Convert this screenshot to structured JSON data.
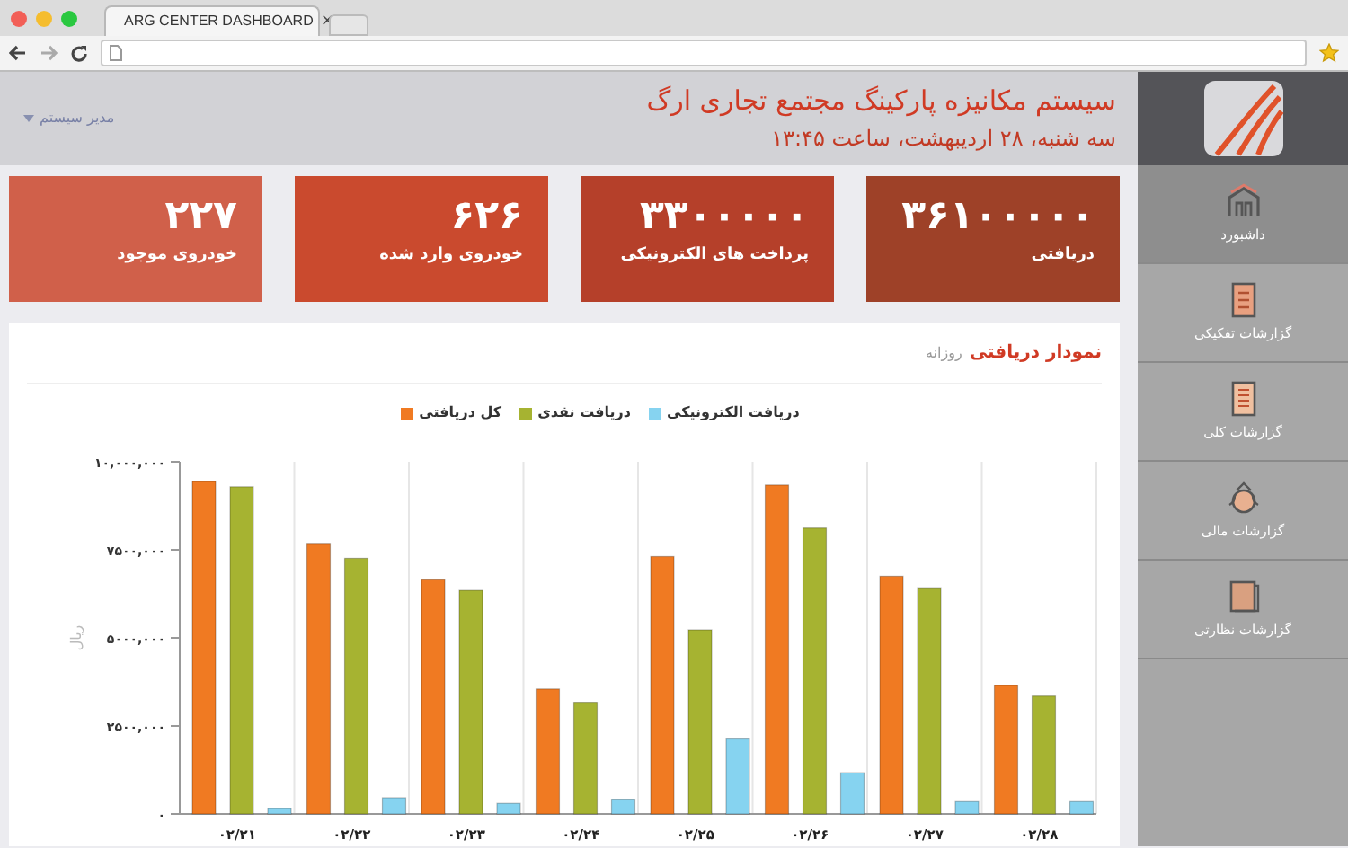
{
  "browser": {
    "tab_title": "ARG CENTER DASHBOARD",
    "tab_close": "×"
  },
  "header": {
    "title": "سیستم مکانیزه پارکینگ مجتمع تجاری ارگ",
    "date": "سه شنبه، ۲۸ اردیبهشت، ساعت ۱۳:۴۵",
    "user": "مدیر سیستم"
  },
  "sidebar": {
    "items": [
      {
        "label": "داشبورد",
        "kind": "home",
        "selected": true
      },
      {
        "label": "گزارشات تفکیکی",
        "kind": "report",
        "selected": false
      },
      {
        "label": "گزارشات کلی",
        "kind": "list",
        "selected": false
      },
      {
        "label": "گزارشات مالی",
        "kind": "money",
        "selected": false
      },
      {
        "label": "گزارشات نظارتی",
        "kind": "book",
        "selected": false
      }
    ]
  },
  "stats": [
    {
      "value": "۳۶۱۰۰۰۰۰",
      "label": "دریافتی",
      "color": "#9e4128"
    },
    {
      "value": "۳۳۰۰۰۰۰",
      "label": "پرداخت های الکترونیکی",
      "color": "#b5402a"
    },
    {
      "value": "۶۲۶",
      "label": "خودروی وارد شده",
      "color": "#ca4a2e"
    },
    {
      "value": "۲۲۷",
      "label": "خودروی موجود",
      "color": "#d0604a"
    }
  ],
  "chart_panel": {
    "title": "نمودار دریافتی",
    "subtitle": "روزانه",
    "chart_data": {
      "type": "bar",
      "legend": "top",
      "ylabel": "ریال",
      "categories": [
        "۰۲/۲۱",
        "۰۲/۲۲",
        "۰۲/۲۳",
        "۰۲/۲۴",
        "۰۲/۲۵",
        "۰۲/۲۶",
        "۰۲/۲۷",
        "۰۲/۲۸"
      ],
      "series": [
        {
          "name": "کل دریافتی",
          "color": "#f07a22",
          "values": [
            9440000,
            7660000,
            6650000,
            3550000,
            7310000,
            9340000,
            6750000,
            3650000
          ]
        },
        {
          "name": "دریافت نقدی",
          "color": "#a6b331",
          "values": [
            9290000,
            7260000,
            6350000,
            3150000,
            5230000,
            8120000,
            6400000,
            3350000
          ]
        },
        {
          "name": "دریافت الکترونیکی",
          "color": "#86d3f0",
          "values": [
            150000,
            460000,
            300000,
            400000,
            2130000,
            1170000,
            350000,
            350000
          ]
        }
      ],
      "ylim": [
        0,
        10000000
      ],
      "yticks": [
        {
          "value": 0,
          "label": "۰"
        },
        {
          "value": 2500000,
          "label": "۲۵۰۰,۰۰۰"
        },
        {
          "value": 5000000,
          "label": "۵۰۰۰,۰۰۰"
        },
        {
          "value": 7500000,
          "label": "۷۵۰۰,۰۰۰"
        },
        {
          "value": 10000000,
          "label": "۱۰,۰۰۰,۰۰۰"
        }
      ]
    }
  }
}
